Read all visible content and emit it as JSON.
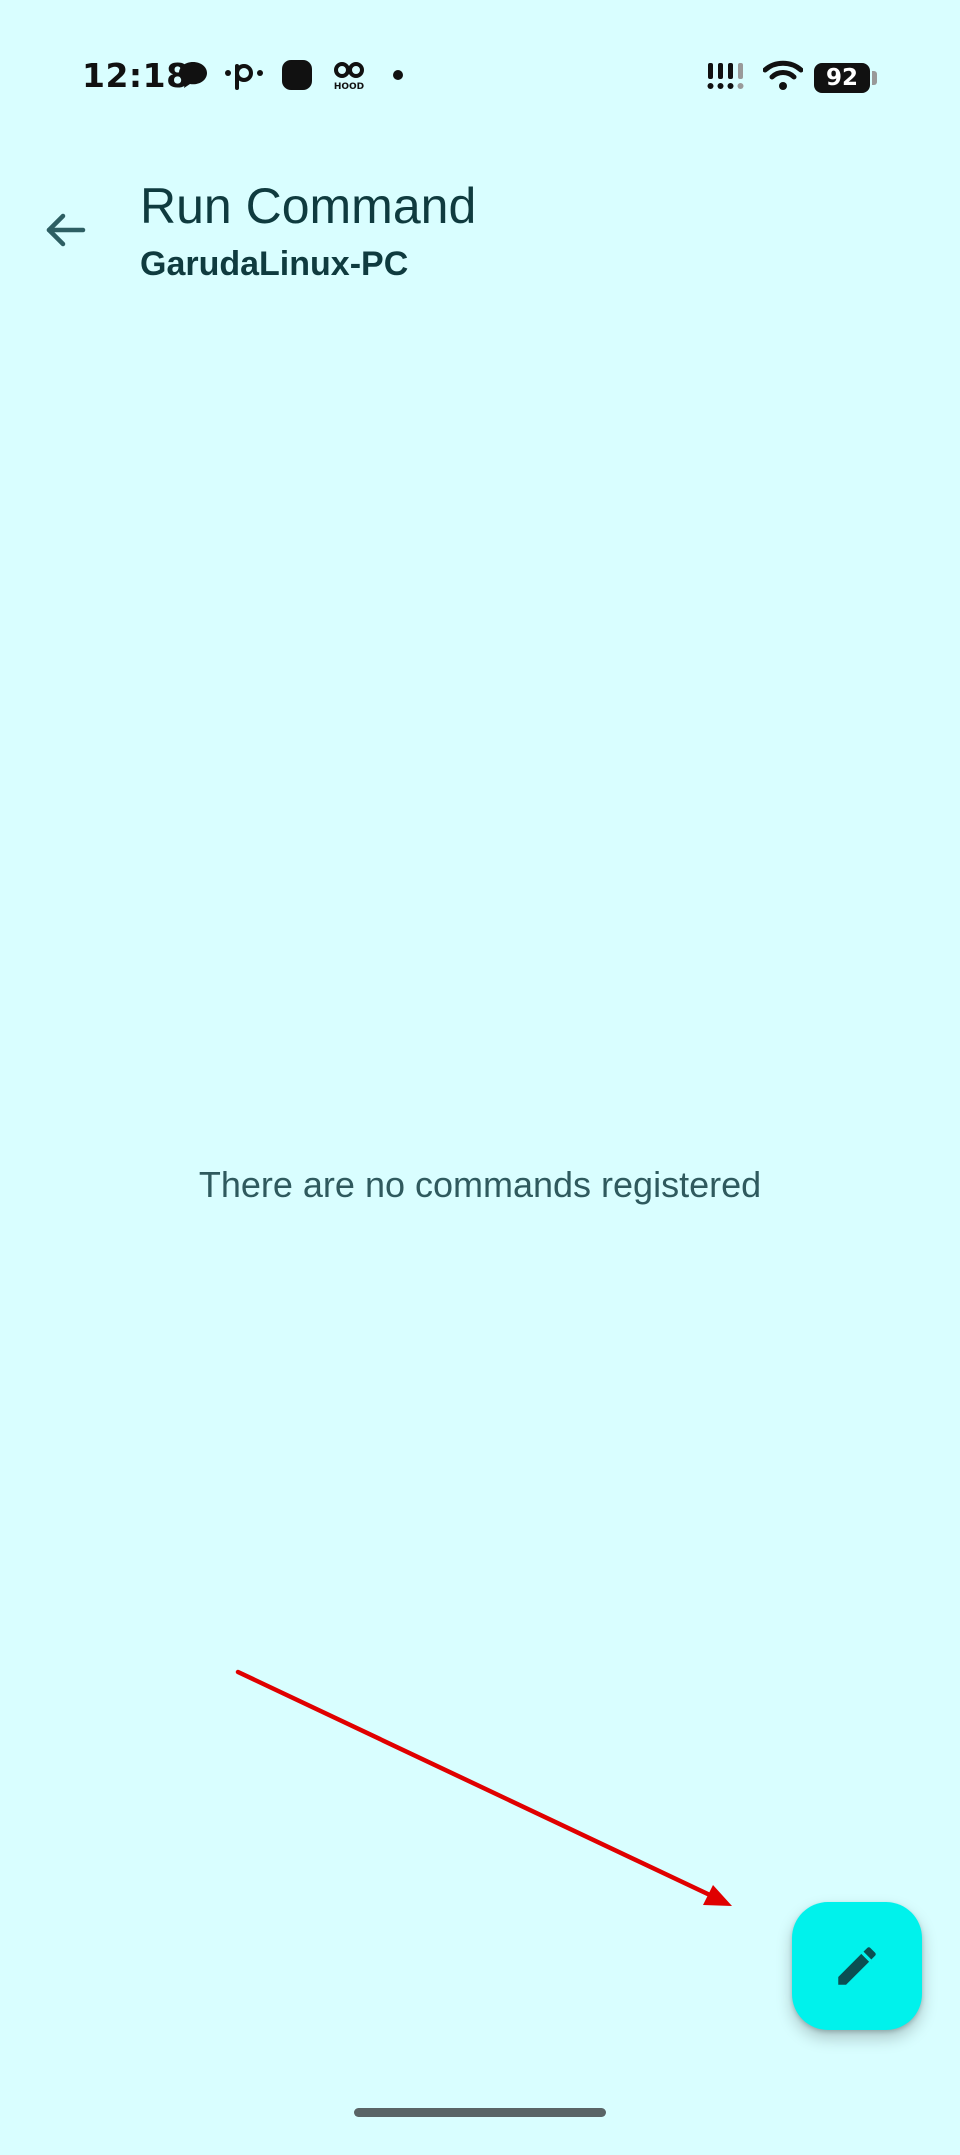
{
  "status_bar": {
    "time": "12:18",
    "battery": "92",
    "left_icons": [
      "chat-bubble-icon",
      "p-dots-icon",
      "rounded-square-icon",
      "hood-app-icon",
      "notification-dot-icon"
    ],
    "hood_label": "HOOD",
    "right_icons": [
      "signal-icon",
      "wifi-icon",
      "battery-icon"
    ]
  },
  "app_bar": {
    "back_icon": "arrow-left-icon",
    "title": "Run Command",
    "subtitle": "GarudaLinux-PC"
  },
  "main": {
    "empty_message": "There are no commands registered"
  },
  "fab": {
    "icon": "pencil-icon"
  },
  "colors": {
    "background": "#d9feff",
    "fab": "#00f2ec",
    "text": "#0f3b3f",
    "annotation_arrow": "#e00000"
  }
}
